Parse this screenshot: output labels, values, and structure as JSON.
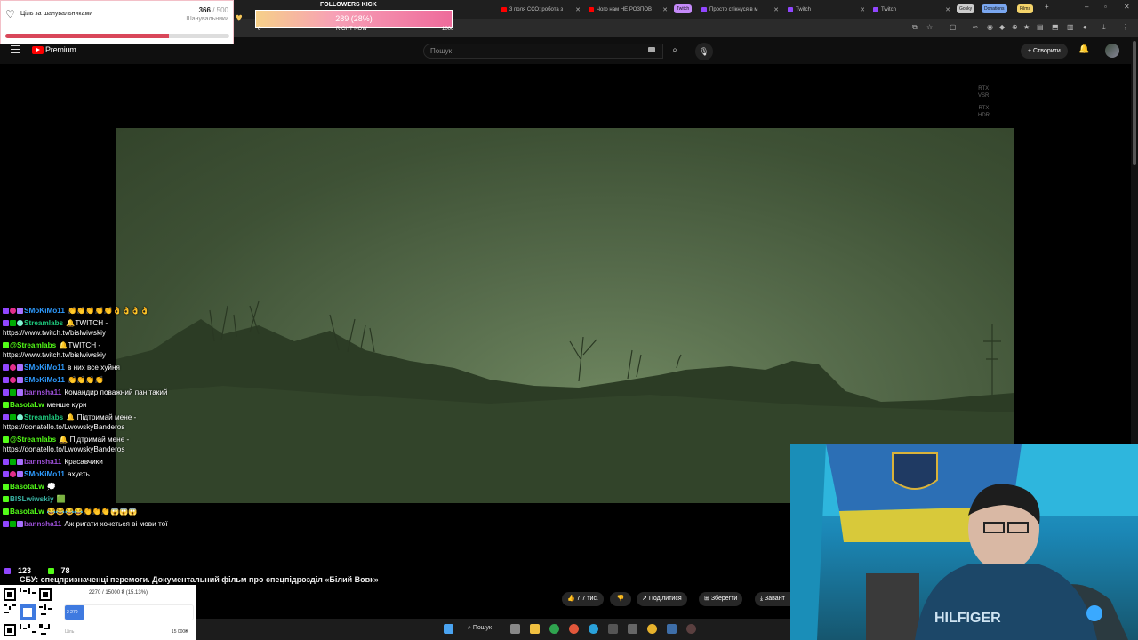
{
  "browser": {
    "tabs": [
      {
        "label": "3 поля ССО: робота з",
        "color": "#ff0000"
      },
      {
        "label": "Чого нам НЕ РОЗПОВ",
        "color": "#ff0000"
      },
      {
        "label": "Twitch",
        "color": "#9146ff"
      },
      {
        "label": "Просто стікнуся в м",
        "color": "#9146ff"
      },
      {
        "label": "Twitch",
        "color": "#9146ff"
      },
      {
        "label": "Twitch",
        "color": "#9146ff"
      }
    ],
    "tab_groups": [
      {
        "label": "Twitch",
        "color": "#c58af9"
      },
      {
        "label": "Gosky",
        "color": "#cccccc"
      },
      {
        "label": "Donations",
        "color": "#7aa7f0"
      },
      {
        "label": "Films",
        "color": "#f3d36a"
      }
    ]
  },
  "youtube": {
    "brand": "Premium",
    "search_placeholder": "Пошук",
    "create_label": "Створити",
    "video_title": "СБУ: спецпризначенці перемоги. Документальний фільм про спецпідрозділ «Білий Вовк»",
    "likes": "7,7 тис.",
    "share_label": "Поділитися",
    "save_label": "Зберегти",
    "download_label": "Завант"
  },
  "rtx": {
    "vsr_top": "RTX",
    "vsr_bottom": "VSR",
    "hdr_top": "RTX",
    "hdr_bottom": "HDR"
  },
  "goal_widget": {
    "title": "Ціль за шанувальниками",
    "current": "366",
    "total": "/ 500",
    "subtitle": "Шанувальники",
    "progress": 0.732,
    "accent": "#d9475a"
  },
  "kick_widget": {
    "title": "FOLLOWERS KICK",
    "bar_text": "289 (28%)",
    "min": "0",
    "now_label": "RIGHT NOW",
    "max": "1000"
  },
  "chat": [
    {
      "badges": [
        "tw",
        "heart",
        "star"
      ],
      "nick": "SMoKiMo11",
      "color": "blue",
      "text": "👏👏👏👏👏👌👌👌👌"
    },
    {
      "badges": [
        "tw",
        "mod",
        "sl"
      ],
      "nick": "Streamlabs",
      "color": "green",
      "text": "🔔TWITCH - https://www.twitch.tv/bislwiwskiy"
    },
    {
      "badges": [
        "kick"
      ],
      "nick": "@Streamlabs",
      "color": "kick",
      "text": "🔔TWITCH - https://www.twitch.tv/bislwiwskiy"
    },
    {
      "badges": [
        "tw",
        "heart",
        "star"
      ],
      "nick": "SMoKiMo11",
      "color": "blue",
      "text": "в них все хуйня"
    },
    {
      "badges": [
        "tw",
        "heart",
        "star"
      ],
      "nick": "SMoKiMo11",
      "color": "blue",
      "text": "👏👏👏👏"
    },
    {
      "badges": [
        "tw",
        "mod",
        "star"
      ],
      "nick": "bannsha11",
      "color": "purple",
      "text": "Командир поважний пан такий"
    },
    {
      "badges": [
        "kick"
      ],
      "nick": "BasotaLw",
      "color": "kick",
      "text": "менше кури"
    },
    {
      "badges": [
        "tw",
        "mod",
        "sl"
      ],
      "nick": "Streamlabs",
      "color": "green",
      "text": "🔔 Підтримай мене - https://donatello.to/LwowskyBanderos"
    },
    {
      "badges": [
        "kick"
      ],
      "nick": "@Streamlabs",
      "color": "kick",
      "text": "🔔 Підтримай мене - https://donatello.to/LwowskyBanderos"
    },
    {
      "badges": [
        "tw",
        "mod",
        "star"
      ],
      "nick": "bannsha11",
      "color": "purple",
      "text": "Красавчики"
    },
    {
      "badges": [
        "tw",
        "heart",
        "star"
      ],
      "nick": "SMoKiMo11",
      "color": "blue",
      "text": "ахуєть"
    },
    {
      "badges": [
        "kick"
      ],
      "nick": "BasotaLw",
      "color": "kick",
      "text": "💭"
    },
    {
      "badges": [
        "kick"
      ],
      "nick": "BISLwiwskiy",
      "color": "teal",
      "text": "🟩"
    },
    {
      "badges": [
        "kick"
      ],
      "nick": "BasotaLw",
      "color": "kick",
      "text": "😂😂😂😂👏👏👏😱😱😱"
    },
    {
      "badges": [
        "tw",
        "mod",
        "star"
      ],
      "nick": "bannsha11",
      "color": "purple",
      "text": "Аж ригати хочеться ві мови тої"
    }
  ],
  "viewers": {
    "twitch": "123",
    "kick": "78"
  },
  "donation_widget": {
    "line": "2270 / 15000 ₴ (15.13%)",
    "fill_label": "2 270",
    "min_label": "Ціль",
    "max_label": "15 000₴",
    "progress": 0.1513,
    "accent": "#3f7ae0"
  },
  "taskbar": {
    "search_label": "Пошук"
  }
}
